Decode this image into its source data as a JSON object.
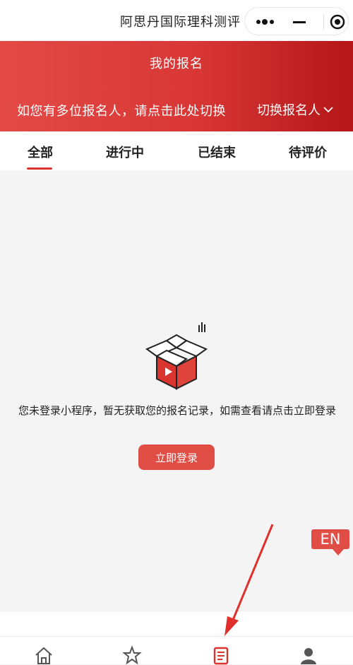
{
  "app": {
    "title": "阿思丹国际理科测评"
  },
  "header": {
    "page_title": "我的报名",
    "hint": "如您有多位报名人，请点击此处切换",
    "switch_label": "切换报名人"
  },
  "tabs": [
    {
      "label": "全部",
      "active": true
    },
    {
      "label": "进行中",
      "active": false
    },
    {
      "label": "已结束",
      "active": false
    },
    {
      "label": "待评价",
      "active": false
    }
  ],
  "empty_state": {
    "message": "您未登录小程序，暂无获取您的报名记录，如需查看请点击立即登录",
    "login_label": "立即登录"
  },
  "lang_badge": "EN",
  "bottom_nav": [
    {
      "icon": "home-icon"
    },
    {
      "icon": "star-icon"
    },
    {
      "icon": "registration-icon",
      "active": true
    },
    {
      "icon": "profile-icon"
    }
  ],
  "colors": {
    "accent": "#df4d45",
    "banner_start": "#e34a45",
    "banner_end": "#b41619"
  }
}
